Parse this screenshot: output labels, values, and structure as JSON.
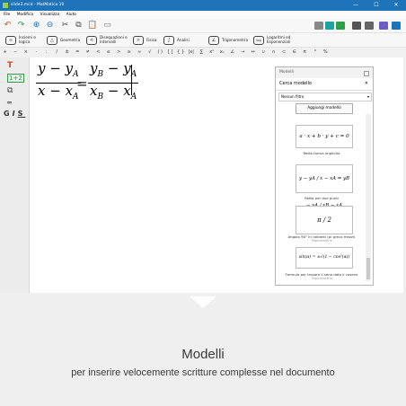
{
  "window": {
    "title": "slide3.mcd - MatMatica 10"
  },
  "menu": [
    "File",
    "Modifica",
    "Visualizza",
    "Aiuto"
  ],
  "categories": [
    {
      "label": "Insiemi e logica",
      "icon": "∞"
    },
    {
      "label": "Geometria",
      "icon": "△"
    },
    {
      "label": "Disequazioni e Intervalli",
      "icon": "<"
    },
    {
      "label": "Fisica",
      "icon": "⚛"
    },
    {
      "label": "Analisi",
      "icon": "∫"
    },
    {
      "label": "Trigonometria",
      "icon": "∠"
    },
    {
      "label": "Logaritmi ed Esponenziali",
      "icon": "log"
    }
  ],
  "symbols": [
    "+",
    "−",
    "×",
    "·",
    ":",
    "/",
    "±",
    "=",
    "≠",
    "<",
    "≤",
    ">",
    "≥",
    "≈",
    "√",
    "( )",
    "[ ]",
    "{ }",
    "|x|",
    "∑",
    "xⁿ",
    "xₙ",
    "∠",
    "→",
    "↔",
    "∪",
    "∩",
    "⊂",
    "∈",
    "π",
    "°",
    "%"
  ],
  "document": {
    "frac1_num": "y − y",
    "frac1_num_sub": "A",
    "frac1_den": "x − x",
    "frac1_den_sub": "A",
    "equals": "=",
    "frac2_num": "y",
    "frac2_num_sub1": "B",
    "frac2_num_mid": " − y",
    "frac2_num_sub2": "A",
    "frac2_den": "x",
    "frac2_den_sub1": "B",
    "frac2_den_mid": " − x",
    "frac2_den_sub2": "A"
  },
  "panel": {
    "header": "Modelli",
    "title": "Cerca modello",
    "filter": "Nessun filtro",
    "add_button": "Aggiungi modello",
    "models": [
      {
        "formula": "a · x + b · y + c = 0",
        "caption": "Retta forma implicita",
        "sub": ""
      },
      {
        "formula": "y − yA / x − xA = yB − yA / xB − xA",
        "caption": "Retta per due punti",
        "sub": ""
      },
      {
        "formula": "π / 2",
        "caption": "Angolo 90° in radianti (pi greco mezzi)",
        "sub": "Trigonometria"
      },
      {
        "formula": "sin(α) = ±√(1 − cos²(α))",
        "caption": "Formula per trovare il seno dato il coseno",
        "sub": "Trigonometria"
      }
    ]
  },
  "footer": {
    "title": "Modelli",
    "subtitle": "per inserire velocemente scritture complesse nel documento"
  },
  "colors": {
    "titlebar": "#1e73b9",
    "accent_green": "#2e9e4a",
    "accent_teal": "#1fa2a2"
  }
}
